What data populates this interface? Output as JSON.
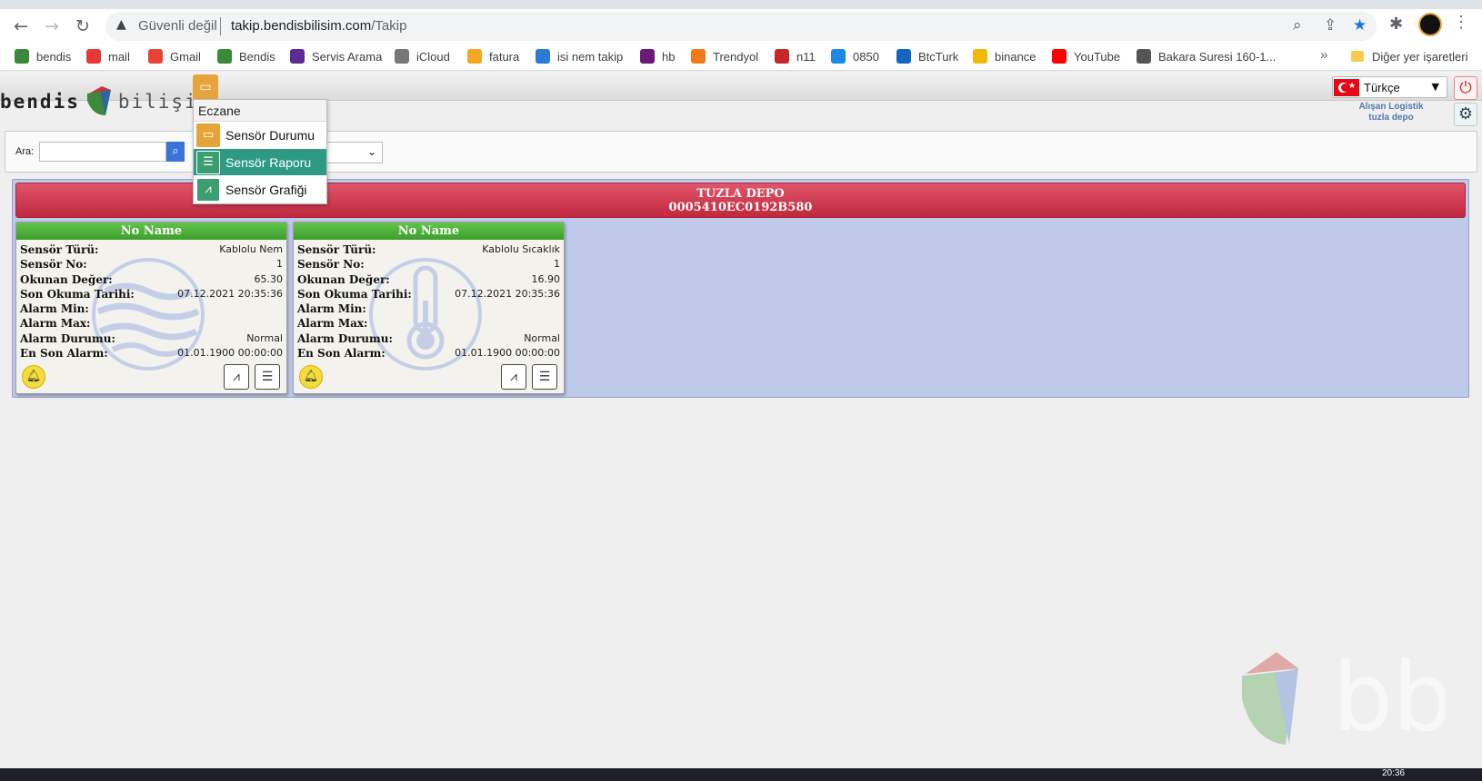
{
  "browser": {
    "security_label": "Güvenli değil",
    "url_domain": "takip.bendisbilisim.com",
    "url_path": "/Takip",
    "bookmarks": [
      {
        "label": "bendis",
        "color": "#3a8a3a"
      },
      {
        "label": "mail",
        "color": "#e53935"
      },
      {
        "label": "Gmail",
        "color": "#ea4335"
      },
      {
        "label": "Bendis",
        "color": "#3a8a3a"
      },
      {
        "label": "Servis Arama",
        "color": "#5b2c91"
      },
      {
        "label": "iCloud",
        "color": "#777777"
      },
      {
        "label": "fatura",
        "color": "#f5a623"
      },
      {
        "label": "isi nem takip",
        "color": "#2b7bd6"
      },
      {
        "label": "hb",
        "color": "#6a1b7a"
      },
      {
        "label": "Trendyol",
        "color": "#f27a1a"
      },
      {
        "label": "n11",
        "color": "#c62828"
      },
      {
        "label": "0850",
        "color": "#1e88e5"
      },
      {
        "label": "BtcTurk",
        "color": "#1565c0"
      },
      {
        "label": "binance",
        "color": "#f0b90b"
      },
      {
        "label": "YouTube",
        "color": "#ff0000"
      },
      {
        "label": "Bakara Suresi 160-1...",
        "color": "#555555"
      }
    ],
    "more_label": "»",
    "other_bookmarks": "Diğer yer işaretleri"
  },
  "app": {
    "logo_left": "bendis",
    "logo_right": "bilişim",
    "language": "Türkçe",
    "account_name": "Alışan Logistik",
    "account_site": "tuzla depo"
  },
  "menu": {
    "header": "Eczane",
    "items": [
      {
        "label": "Sensör Durumu",
        "icon": "monitor-icon",
        "active": false
      },
      {
        "label": "Sensör Raporu",
        "icon": "report-icon",
        "active": true
      },
      {
        "label": "Sensör Grafiği",
        "icon": "chart-icon",
        "active": false
      }
    ]
  },
  "search": {
    "label": "Ara:",
    "value": ""
  },
  "group": {
    "name": "TUZLA DEPO",
    "device_id": "0005410EC0192B580"
  },
  "cards": [
    {
      "title": "No Name",
      "bg_icon": "humidity-waves-icon",
      "rows": [
        {
          "key": "Sensör Türü:",
          "value": "Kablolu Nem"
        },
        {
          "key": "Sensör No:",
          "value": "1"
        },
        {
          "key": "Okunan Değer:",
          "value": "65.30"
        },
        {
          "key": "Son Okuma Tarihi:",
          "value": "07.12.2021 20:35:36"
        },
        {
          "key": "Alarm Min:",
          "value": ""
        },
        {
          "key": "Alarm Max:",
          "value": ""
        },
        {
          "key": "Alarm Durumu:",
          "value": "Normal"
        },
        {
          "key": "En Son Alarm:",
          "value": "01.01.1900 00:00:00"
        }
      ]
    },
    {
      "title": "No Name",
      "bg_icon": "thermometer-icon",
      "rows": [
        {
          "key": "Sensör Türü:",
          "value": "Kablolu Sıcaklık"
        },
        {
          "key": "Sensör No:",
          "value": "1"
        },
        {
          "key": "Okunan Değer:",
          "value": "16.90"
        },
        {
          "key": "Son Okuma Tarihi:",
          "value": "07.12.2021 20:35:36"
        },
        {
          "key": "Alarm Min:",
          "value": ""
        },
        {
          "key": "Alarm Max:",
          "value": ""
        },
        {
          "key": "Alarm Durumu:",
          "value": "Normal"
        },
        {
          "key": "En Son Alarm:",
          "value": "01.01.1900 00:00:00"
        }
      ]
    }
  ],
  "taskbar": {
    "time": "20:36"
  },
  "colors": {
    "group_header": "#c9354b",
    "card_title": "#4caf38",
    "panel_bg": "#bfc9ea",
    "menu_active": "#2e9a84",
    "menu_trigger": "#e5a53a"
  }
}
